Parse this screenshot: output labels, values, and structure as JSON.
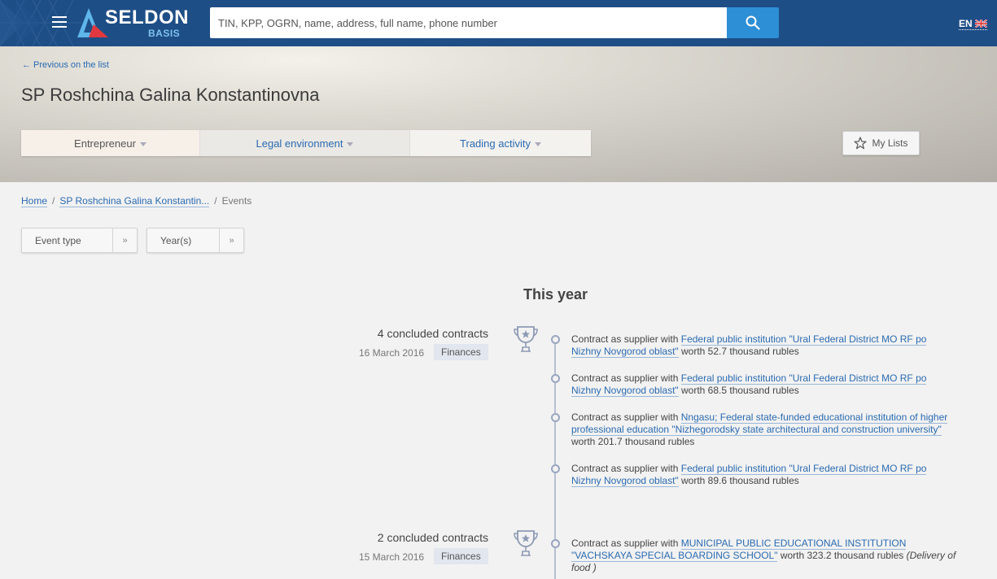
{
  "app": {
    "logo_text": "SELDON",
    "logo_sub": "BASIS",
    "colors": {
      "topbar": "#1e4e86",
      "accent": "#2d8fd5",
      "link": "#2a6ab0"
    }
  },
  "search": {
    "placeholder": "TIN, KPP, OGRN, name, address, full name, phone number",
    "value": ""
  },
  "language": {
    "label": "EN",
    "flag_icon": "uk-flag-icon"
  },
  "header": {
    "back_link": "← Previous on the list",
    "title": "SP Roshchina Galina Konstantinovna",
    "tabs": [
      {
        "label": "Entrepreneur"
      },
      {
        "label": "Legal environment"
      },
      {
        "label": "Trading activity"
      }
    ],
    "my_lists_label": "My Lists"
  },
  "breadcrumb": {
    "home": "Home",
    "entity": "SP Roshchina Galina Konstantin...",
    "current": "Events"
  },
  "filters": {
    "event_type": "Event type",
    "years": "Year(s)"
  },
  "timeline": {
    "section_title": "This year",
    "groups": [
      {
        "title": "4 concluded contracts",
        "date": "16 March 2016",
        "tag": "Finances",
        "events": [
          {
            "prefix": "Contract as supplier with ",
            "link": "Federal public institution \"Ural Federal District MO RF po Nizhny Novgorod oblast\"",
            "suffix": " worth 52.7 thousand rubles",
            "note": ""
          },
          {
            "prefix": "Contract as supplier with ",
            "link": "Federal public institution \"Ural Federal District MO RF po Nizhny Novgorod oblast\"",
            "suffix": " worth 68.5 thousand rubles",
            "note": ""
          },
          {
            "prefix": "Contract as supplier with ",
            "link": "Nngasu; Federal state-funded educational institution of higher professional education \"Nizhegorodsky state architectural and construction university\"",
            "suffix": " worth 201.7 thousand rubles",
            "note": ""
          },
          {
            "prefix": "Contract as supplier with ",
            "link": "Federal public institution \"Ural Federal District MO RF po Nizhny Novgorod oblast\"",
            "suffix": " worth 89.6 thousand rubles",
            "note": ""
          }
        ]
      },
      {
        "title": "2 concluded contracts",
        "date": "15 March 2016",
        "tag": "Finances",
        "events": [
          {
            "prefix": "Contract as supplier with ",
            "link": "MUNICIPAL PUBLIC EDUCATIONAL INSTITUTION \"VACHSKAYA SPECIAL BOARDING SCHOOL\"",
            "suffix": " worth 323.2 thousand rubles ",
            "note": "(Delivery of food )"
          }
        ]
      }
    ]
  }
}
